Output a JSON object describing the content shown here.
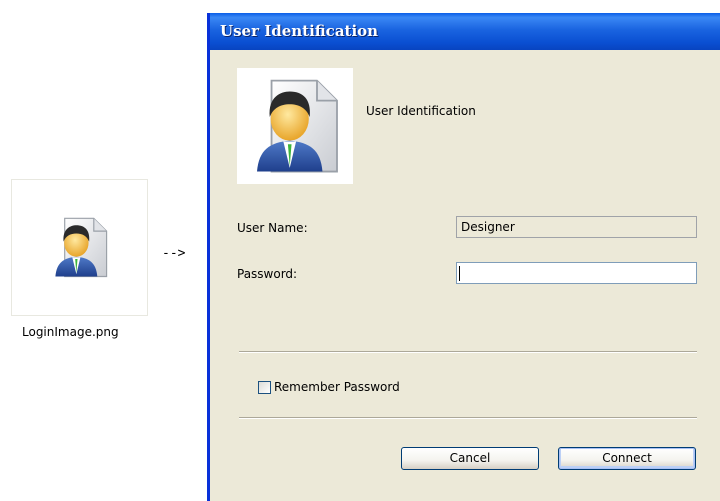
{
  "thumbnail": {
    "filename": "LoginImage.png",
    "icon": "user-id-card-icon"
  },
  "arrow": "-->",
  "dialog": {
    "title": "User Identification",
    "header_icon": "user-id-card-icon",
    "header_text": "User Identification",
    "user_name_label": "User Name:",
    "user_name_value": "Designer",
    "password_label": "Password:",
    "password_value": "",
    "remember_label": "Remember Password",
    "remember_checked": false,
    "cancel_label": "Cancel",
    "connect_label": "Connect"
  },
  "colors": {
    "titlebar": "#0a5ee8",
    "dialog_bg": "#ece9d8",
    "button_border": "#003c74"
  }
}
